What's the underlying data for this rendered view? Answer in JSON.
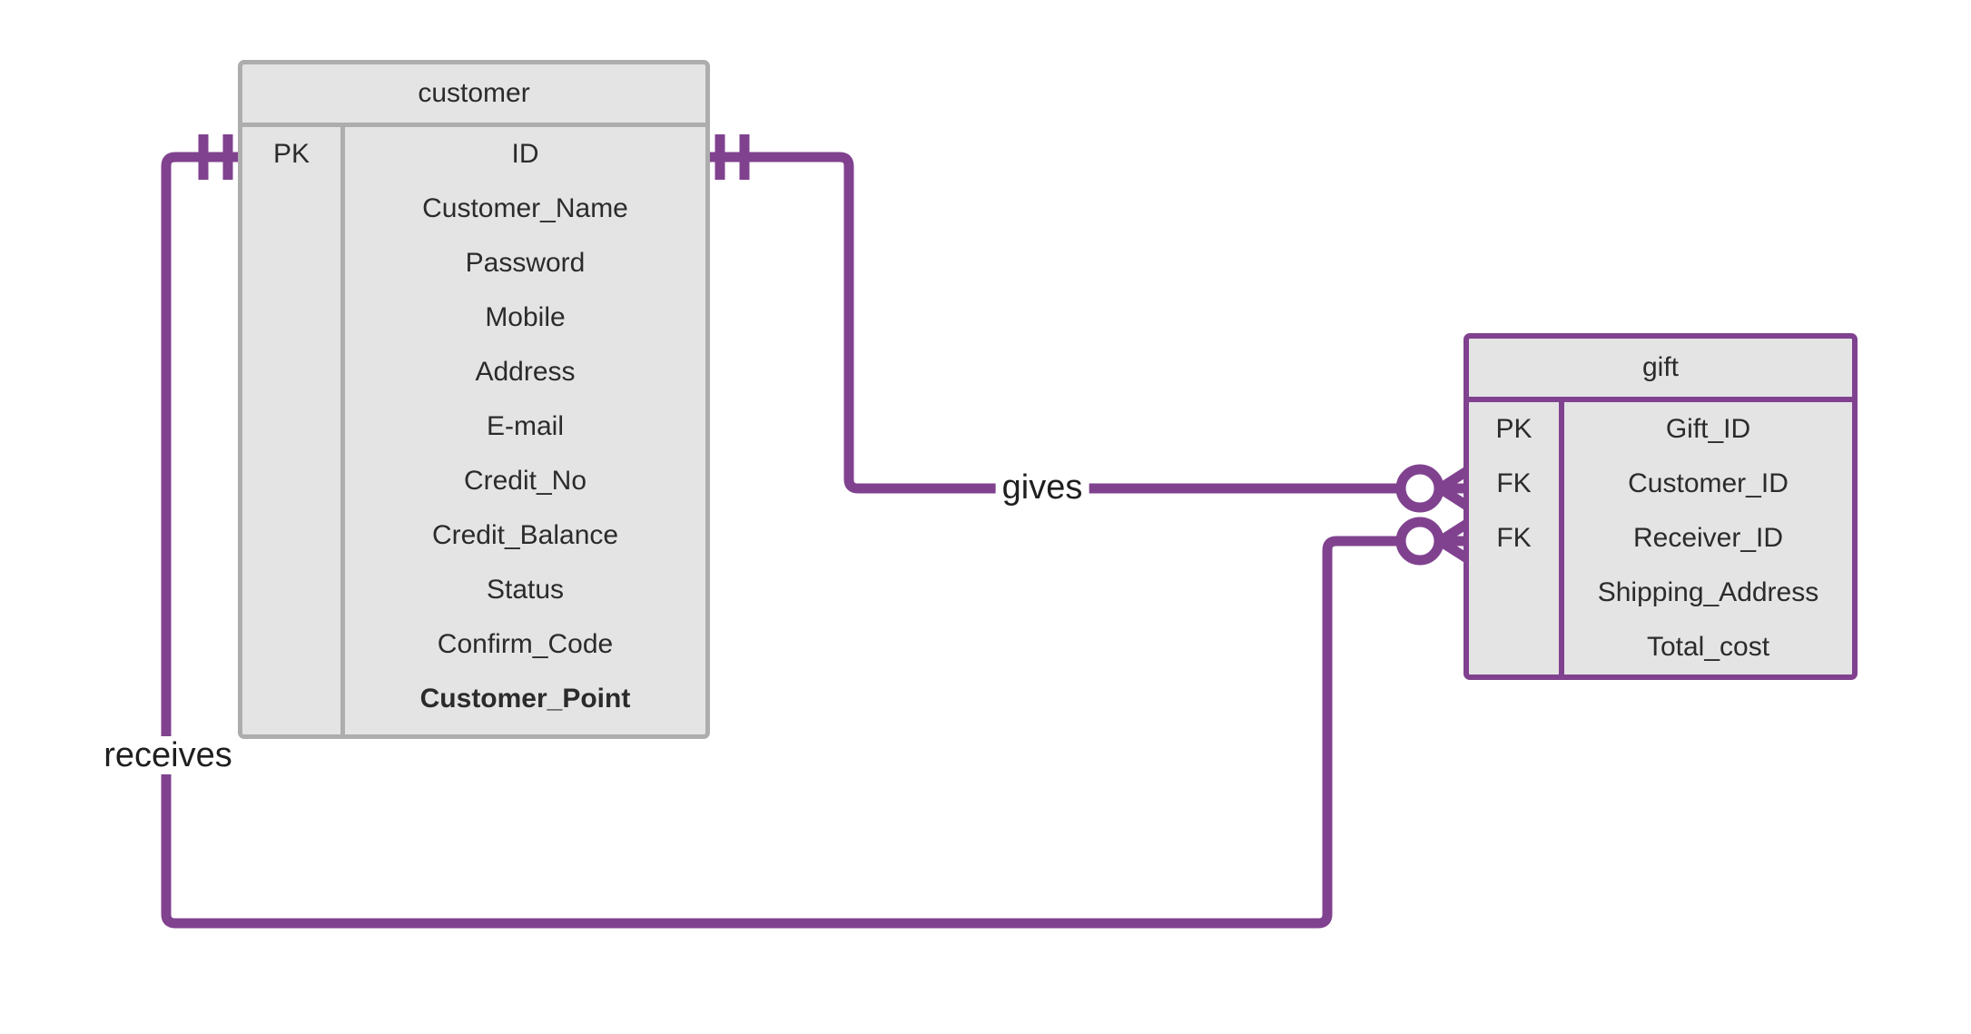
{
  "diagram": {
    "type": "entity-relationship-diagram",
    "notation": "crow's-foot",
    "background_color": "#ffffff",
    "accent_color": "#80428f",
    "entity_fill_color": "#e4e4e4",
    "entity_border_color": "#adadad",
    "text_color": "#2b2b2b"
  },
  "entities": [
    {
      "id": "customer",
      "title": "customer",
      "selected": false,
      "border_color": "#adadad",
      "rows": [
        {
          "key": "PK",
          "attribute": "ID",
          "bold": false
        },
        {
          "key": "",
          "attribute": "Customer_Name",
          "bold": false
        },
        {
          "key": "",
          "attribute": "Password",
          "bold": false
        },
        {
          "key": "",
          "attribute": "Mobile",
          "bold": false
        },
        {
          "key": "",
          "attribute": "Address",
          "bold": false
        },
        {
          "key": "",
          "attribute": "E-mail",
          "bold": false
        },
        {
          "key": "",
          "attribute": "Credit_No",
          "bold": false
        },
        {
          "key": "",
          "attribute": "Credit_Balance",
          "bold": false
        },
        {
          "key": "",
          "attribute": "Status",
          "bold": false
        },
        {
          "key": "",
          "attribute": "Confirm_Code",
          "bold": false
        },
        {
          "key": "",
          "attribute": "Customer_Point",
          "bold": true
        }
      ]
    },
    {
      "id": "gift",
      "title": "gift",
      "selected": true,
      "border_color": "#80428f",
      "rows": [
        {
          "key": "PK",
          "attribute": "Gift_ID",
          "bold": false
        },
        {
          "key": "FK",
          "attribute": "Customer_ID",
          "bold": false
        },
        {
          "key": "FK",
          "attribute": "Receiver_ID",
          "bold": false
        },
        {
          "key": "",
          "attribute": "Shipping_Address",
          "bold": false
        },
        {
          "key": "",
          "attribute": "Total_cost",
          "bold": false
        }
      ]
    }
  ],
  "relationships": [
    {
      "id": "gives",
      "label": "gives",
      "from_entity": "customer",
      "to_entity": "gift",
      "to_attribute": "Customer_ID",
      "from_cardinality": "one-and-only-one",
      "to_cardinality": "zero-or-many"
    },
    {
      "id": "receives",
      "label": "receives",
      "from_entity": "customer",
      "to_entity": "gift",
      "to_attribute": "Receiver_ID",
      "from_cardinality": "one-and-only-one",
      "to_cardinality": "zero-or-many"
    }
  ]
}
